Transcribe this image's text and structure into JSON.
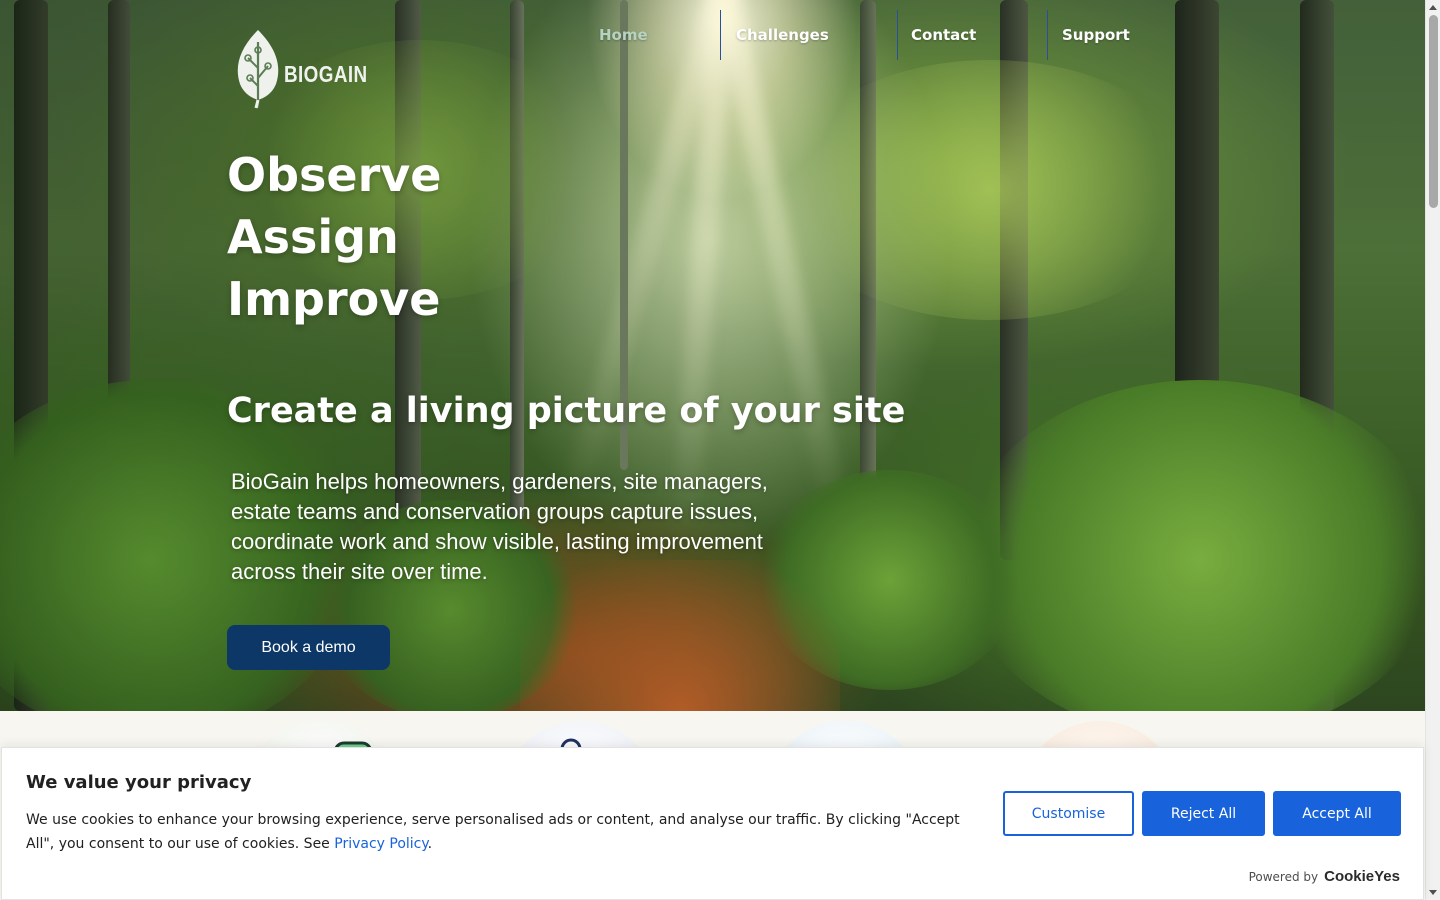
{
  "brand": {
    "name": "BIOGAIN"
  },
  "nav": {
    "items": [
      {
        "label": "Home",
        "active": true
      },
      {
        "label": "Challenges",
        "active": false
      },
      {
        "label": "Contact",
        "active": false
      },
      {
        "label": "Support",
        "active": false
      }
    ]
  },
  "hero": {
    "headline": [
      "Observe",
      "Assign",
      "Improve"
    ],
    "subheading": "Create a living picture of your site",
    "description": "BioGain helps homeowners, gardeners, site managers, estate teams and conservation groups capture issues, coordinate work and show visible, lasting improvement across their site over time.",
    "cta_label": "Book a demo"
  },
  "cookie_banner": {
    "title": "We value your privacy",
    "text": "We use cookies to enhance your browsing experience, serve personalised ads or content, and analyse our traffic. By clicking \"Accept All\", you consent to our use of cookies. See ",
    "link_label": "Privacy Policy",
    "text_end": ".",
    "buttons": {
      "customise": "Customise",
      "reject": "Reject All",
      "accept": "Accept All"
    },
    "powered_by_label": "Powered by",
    "powered_by_brand": "CookieYes"
  },
  "colors": {
    "cta_background": "#0d3766",
    "nav_active": "#b5d3c0",
    "cookie_accent": "#1863dc",
    "features_background": "#f8f6f0"
  },
  "icons": [
    "leaf-circuit-logo-icon",
    "scroll-up-arrow-icon",
    "scroll-down-arrow-icon"
  ]
}
